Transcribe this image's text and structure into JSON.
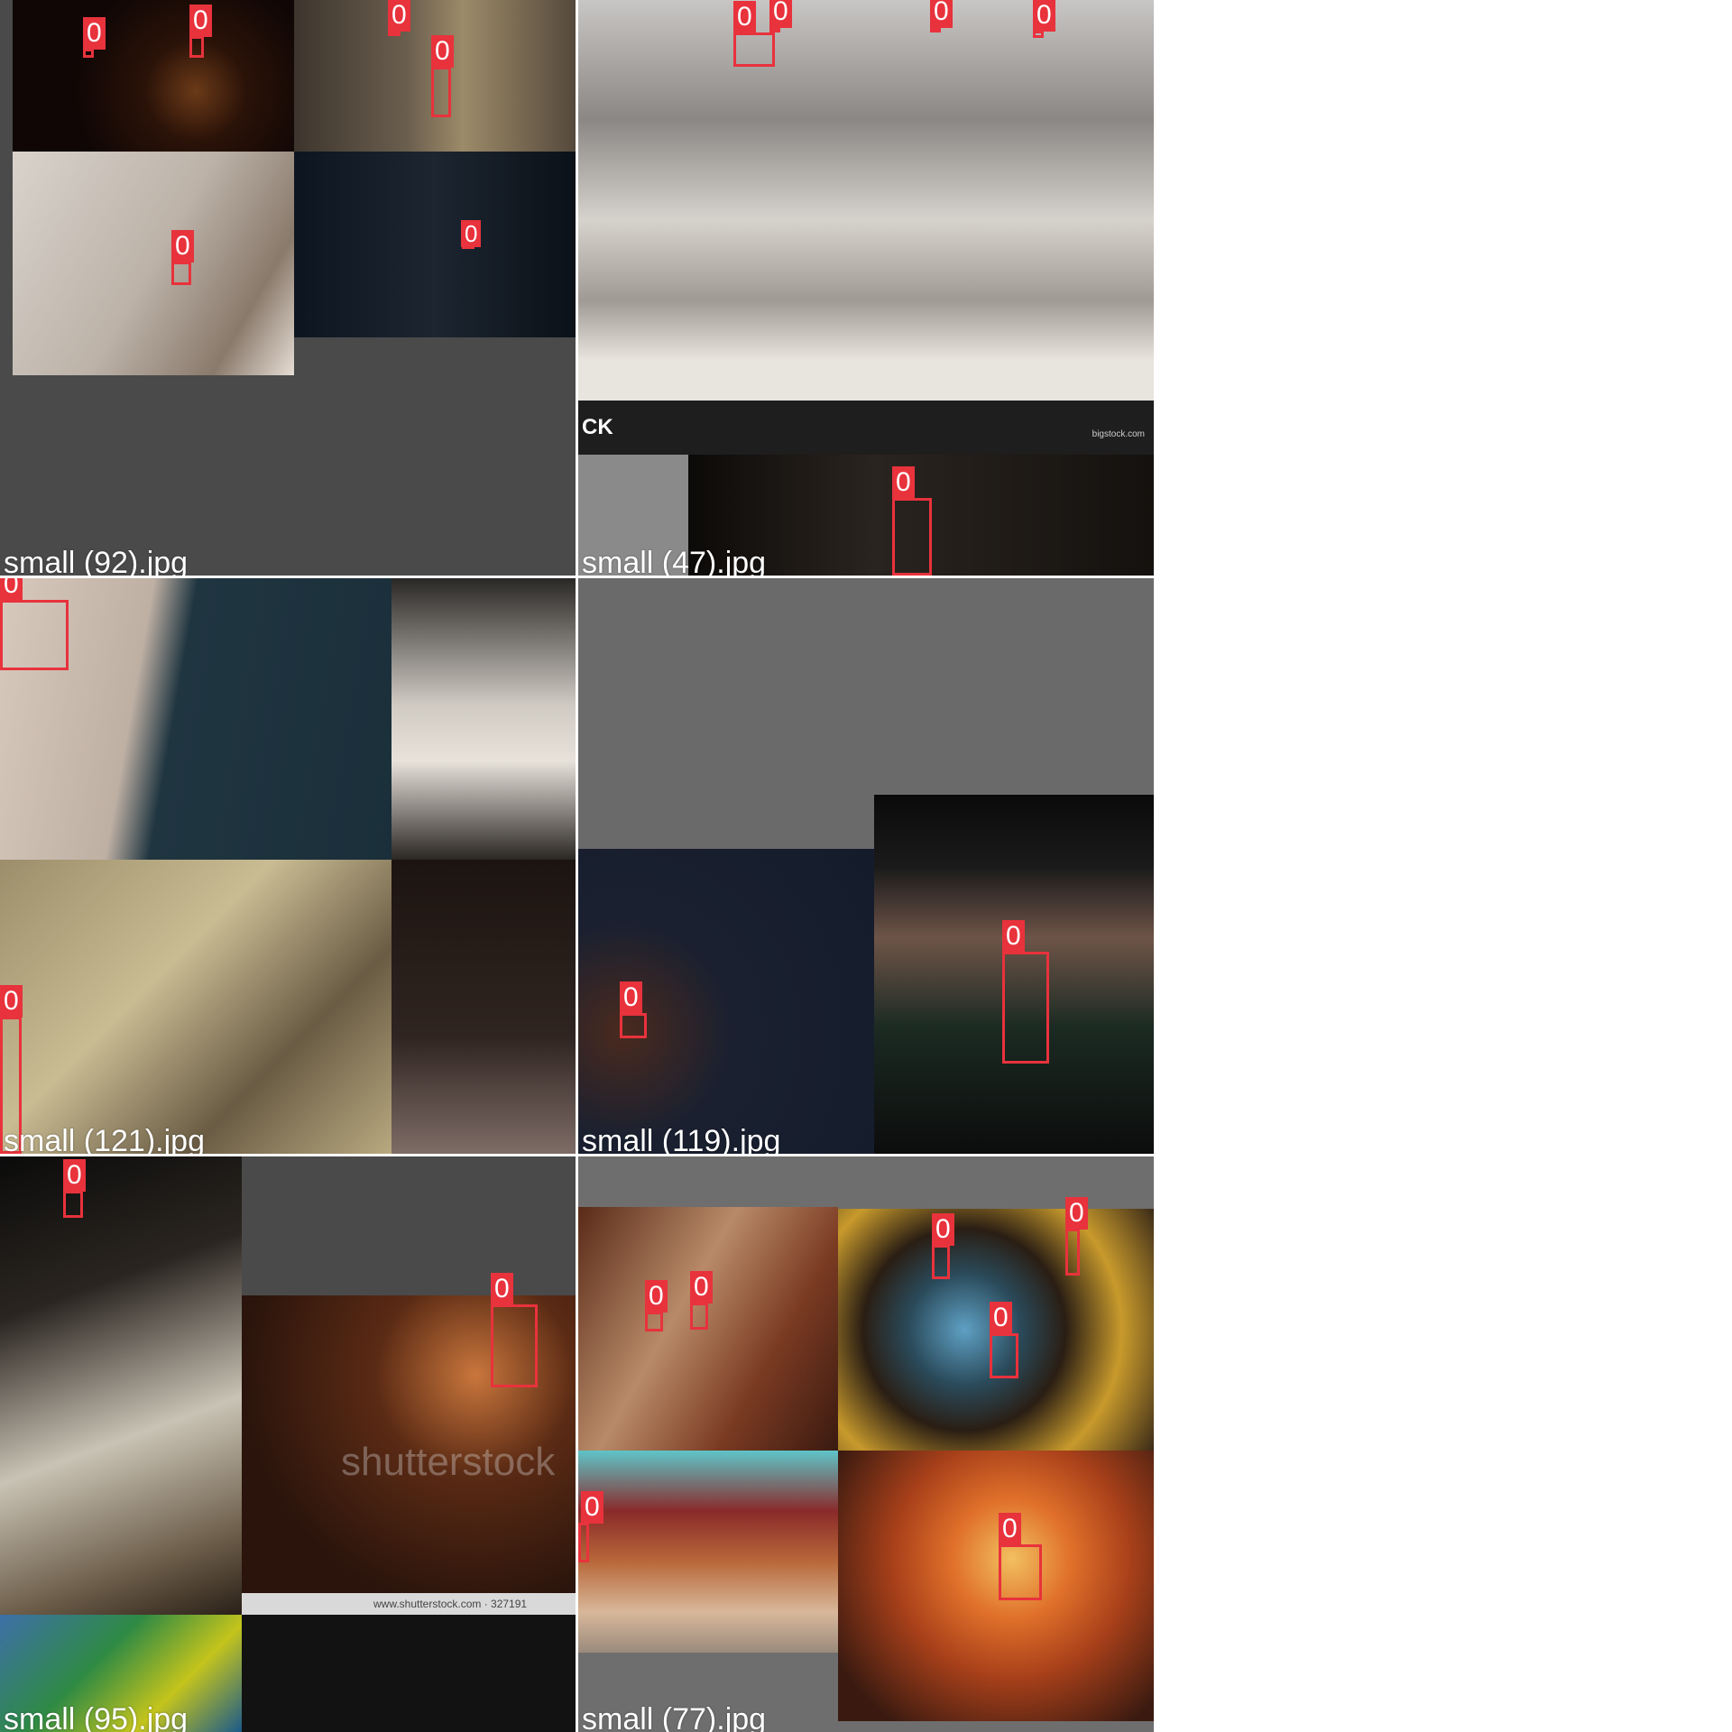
{
  "tiles": [
    {
      "caption": "small (92).jpg",
      "boxes": [
        "0",
        "0",
        "0",
        "0",
        "0",
        "0"
      ]
    },
    {
      "caption": "small (47).jpg",
      "boxes": [
        "0",
        "0",
        "0",
        "0",
        "0"
      ]
    },
    {
      "caption": "small (121).jpg",
      "boxes": [
        "0",
        "0"
      ]
    },
    {
      "caption": "small (119).jpg",
      "boxes": [
        "0",
        "0"
      ]
    },
    {
      "caption": "small (95).jpg",
      "boxes": [
        "0",
        "0"
      ]
    },
    {
      "caption": "small (77).jpg",
      "boxes": [
        "0",
        "0",
        "0",
        "0",
        "0",
        "0"
      ]
    }
  ],
  "watermarks": {
    "shutterstock": "shutterstock",
    "shutterstock_url": "www.shutterstock.com · 327191",
    "bigstock": "CK",
    "bigstock_url": "bigstock.com"
  },
  "colors": {
    "box": "#e8323c",
    "caption": "#ffffff",
    "pad": "#4a4a4a"
  }
}
